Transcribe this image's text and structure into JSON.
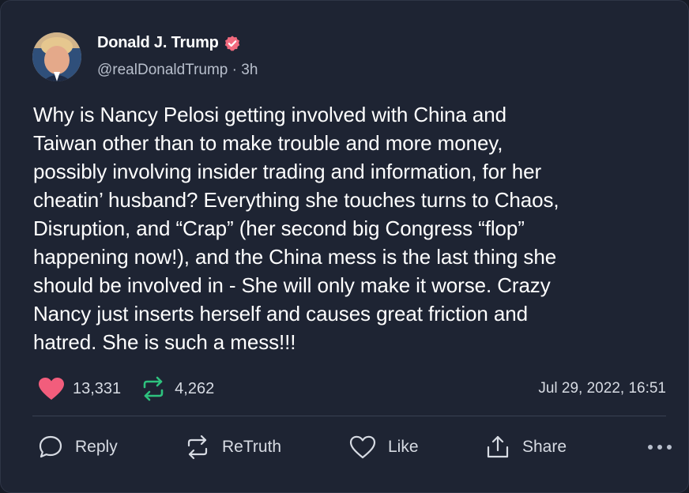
{
  "post": {
    "author_name": "Donald J. Trump",
    "handle": "@realDonaldTrump",
    "separator": "·",
    "time_ago": "3h",
    "text": "Why is Nancy Pelosi getting involved with China and\nTaiwan other than to make trouble and more money,\npossibly involving insider trading and information, for her\ncheatin’ husband? Everything she touches turns to Chaos,\nDisruption, and “Crap” (her second big Congress “flop”\nhappening now!), and the China mess is the last thing she\nshould be involved in - She will only make it worse. Crazy\nNancy just inserts herself and causes great friction and\nhatred. She is such a mess!!!",
    "likes_count": "13,331",
    "retruths_count": "4,262",
    "timestamp": "Jul 29, 2022, 16:51"
  },
  "actions": {
    "reply_label": "Reply",
    "retruth_label": "ReTruth",
    "like_label": "Like",
    "share_label": "Share"
  },
  "colors": {
    "background": "#1e2433",
    "like_heart": "#f25d7c",
    "retruth_green": "#2ec27e",
    "verified_badge": "#f26a7e"
  },
  "icons": {
    "heart_filled": "heart-icon",
    "retruth": "retruth-icon",
    "reply": "speech-bubble-icon",
    "like": "heart-outline-icon",
    "share": "share-icon",
    "more": "more-dots-icon",
    "verified": "verified-badge-icon"
  }
}
